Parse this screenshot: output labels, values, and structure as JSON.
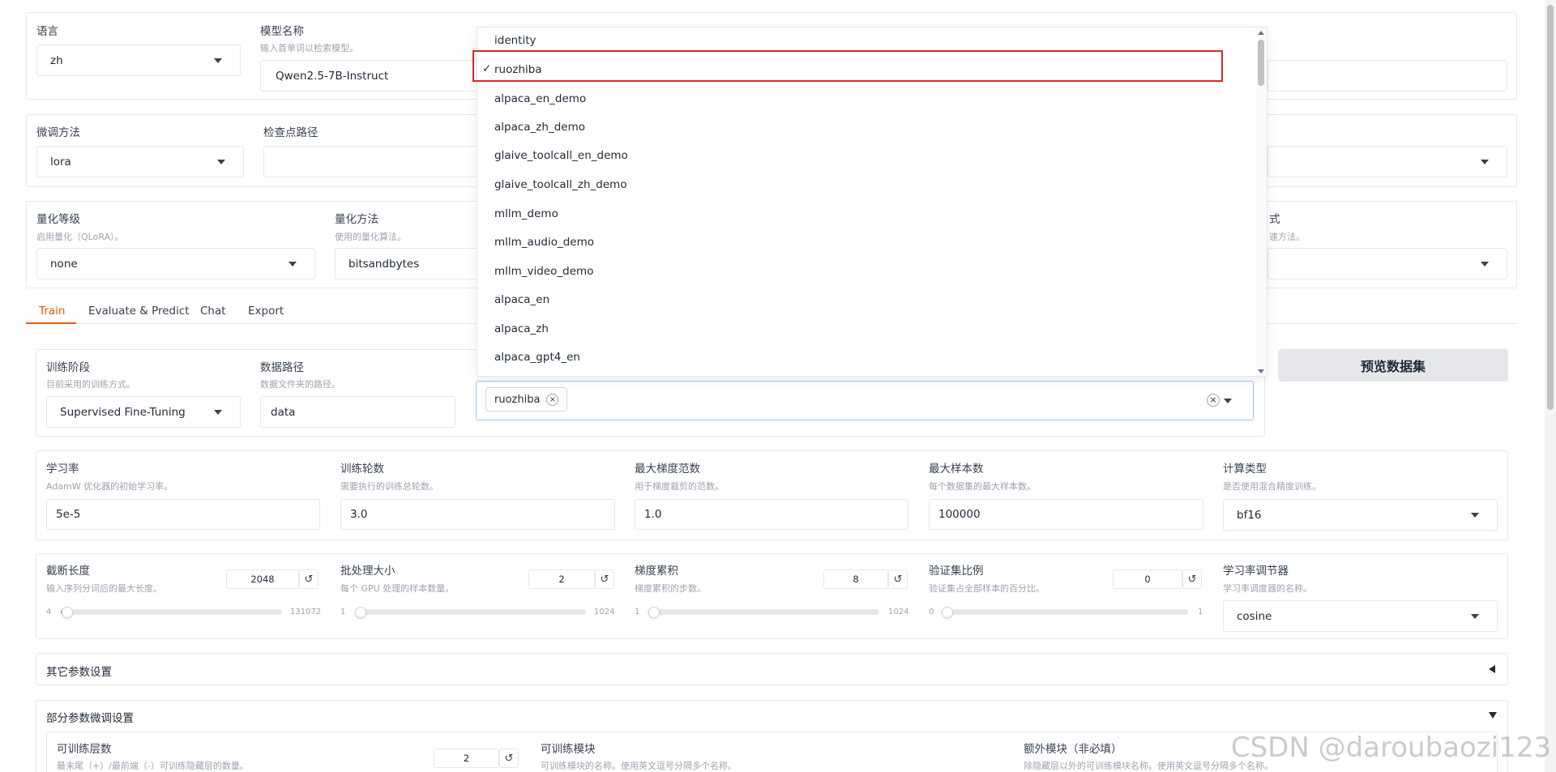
{
  "top": {
    "language_label": "语言",
    "language_value": "zh",
    "model_label": "模型名称",
    "model_hint": "输入首单词以检索模型。",
    "model_value": "Qwen2.5-7B-Instruct"
  },
  "finetune": {
    "method_label": "微调方法",
    "method_value": "lora",
    "checkpoint_label": "检查点路径"
  },
  "quant": {
    "level_label": "量化等级",
    "level_hint": "启用量化（QLoRA）。",
    "level_value": "none",
    "method_label": "量化方法",
    "method_hint": "使用的量化算法。",
    "method_value": "bitsandbytes",
    "accel_label_partial": "式",
    "accel_hint_partial": "速方法。"
  },
  "tabs": [
    "Train",
    "Evaluate & Predict",
    "Chat",
    "Export"
  ],
  "train": {
    "stage_label": "训练阶段",
    "stage_hint": "目前采用的训练方式。",
    "stage_value": "Supervised Fine-Tuning",
    "datadir_label": "数据路径",
    "datadir_hint": "数据文件夹的路径。",
    "datadir_value": "data",
    "dataset_chip": "ruozhiba",
    "chip_x": "×",
    "clear_x": "×",
    "preview_button": "预览数据集"
  },
  "dropdown": {
    "options": [
      "identity",
      "ruozhiba",
      "alpaca_en_demo",
      "alpaca_zh_demo",
      "glaive_toolcall_en_demo",
      "glaive_toolcall_zh_demo",
      "mllm_demo",
      "mllm_audio_demo",
      "mllm_video_demo",
      "alpaca_en",
      "alpaca_zh",
      "alpaca_gpt4_en"
    ],
    "checkmark": "✓"
  },
  "params": {
    "lr_label": "学习率",
    "lr_hint": "AdamW 优化器的初始学习率。",
    "lr_value": "5e-5",
    "epochs_label": "训练轮数",
    "epochs_hint": "需要执行的训练总轮数。",
    "epochs_value": "3.0",
    "maxgrad_label": "最大梯度范数",
    "maxgrad_hint": "用于梯度裁剪的范数。",
    "maxgrad_value": "1.0",
    "maxsamples_label": "最大样本数",
    "maxsamples_hint": "每个数据集的最大样本数。",
    "maxsamples_value": "100000",
    "compute_label": "计算类型",
    "compute_hint": "是否使用混合精度训练。",
    "compute_value": "bf16"
  },
  "sliders": {
    "cutoff_label": "截断长度",
    "cutoff_hint": "输入序列分词后的最大长度。",
    "cutoff_value": "2048",
    "cutoff_min": "4",
    "cutoff_max": "131072",
    "batch_label": "批处理大小",
    "batch_hint": "每个 GPU 处理的样本数量。",
    "batch_value": "2",
    "batch_min": "1",
    "batch_max": "1024",
    "accum_label": "梯度累积",
    "accum_hint": "梯度累积的步数。",
    "accum_value": "8",
    "accum_min": "1",
    "accum_max": "1024",
    "val_label": "验证集比例",
    "val_hint": "验证集占全部样本的百分比。",
    "val_value": "0",
    "val_min": "0",
    "val_max": "1",
    "sched_label": "学习率调节器",
    "sched_hint": "学习率调度器的名称。",
    "sched_value": "cosine",
    "reset_glyph": "↺"
  },
  "accordions": {
    "other_title": "其它参数设置",
    "partial_title": "部分参数微调设置"
  },
  "partial": {
    "layers_label": "可训练层数",
    "layers_hint": "最末尾（+）/最前端（-）可训练隐藏层的数量。",
    "layers_value": "2",
    "modules_label": "可训练模块",
    "modules_hint": "可训练模块的名称。使用英文逗号分隔多个名称。",
    "extra_label": "额外模块（非必填）",
    "extra_hint": "除隐藏层以外的可训练模块名称。使用英文逗号分隔多个名称。"
  },
  "watermark": "CSDN @daroubaozi123"
}
